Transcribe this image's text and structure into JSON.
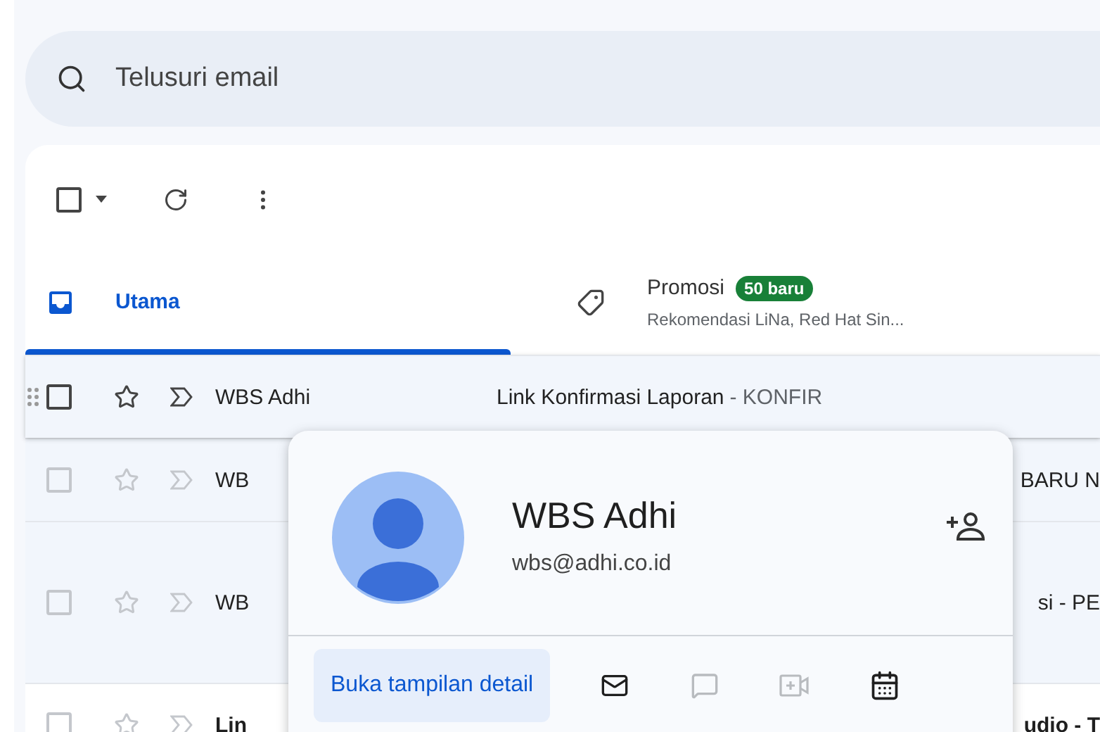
{
  "search": {
    "placeholder": "Telusuri email"
  },
  "toolbar": {
    "select_all_checked": false
  },
  "tabs": [
    {
      "label": "Utama",
      "selected": true,
      "kind": "inbox"
    },
    {
      "label": "Promosi",
      "selected": false,
      "kind": "tag",
      "badge": "50 baru",
      "subtitle": "Rekomendasi LiNa, Red Hat Sin..."
    }
  ],
  "rows": [
    {
      "sender": "WBS Adhi",
      "subject": "Link Konfirmasi Laporan",
      "snippet": "- KONFIR",
      "unread": false,
      "hovered": true,
      "checked": false,
      "starred": false,
      "covered": false
    },
    {
      "sender": "WB",
      "subject": "BARU N",
      "unread": false,
      "hovered": false,
      "checked": false,
      "starred": false,
      "covered": true
    },
    {
      "sender": "WB",
      "subject": "si - PE",
      "unread": false,
      "hovered": false,
      "checked": false,
      "starred": false,
      "covered": true,
      "tall": true
    },
    {
      "sender": "Lin",
      "subject": "udio - T",
      "unread": true,
      "hovered": false,
      "checked": false,
      "starred": false,
      "covered": true
    }
  ],
  "contact_card": {
    "name": "WBS Adhi",
    "email": "wbs@adhi.co.id",
    "detail_button": "Buka tampilan detail",
    "actions": [
      {
        "kind": "mail",
        "disabled": false
      },
      {
        "kind": "chat",
        "disabled": true
      },
      {
        "kind": "video",
        "disabled": true
      },
      {
        "kind": "calendar",
        "disabled": false
      }
    ]
  }
}
